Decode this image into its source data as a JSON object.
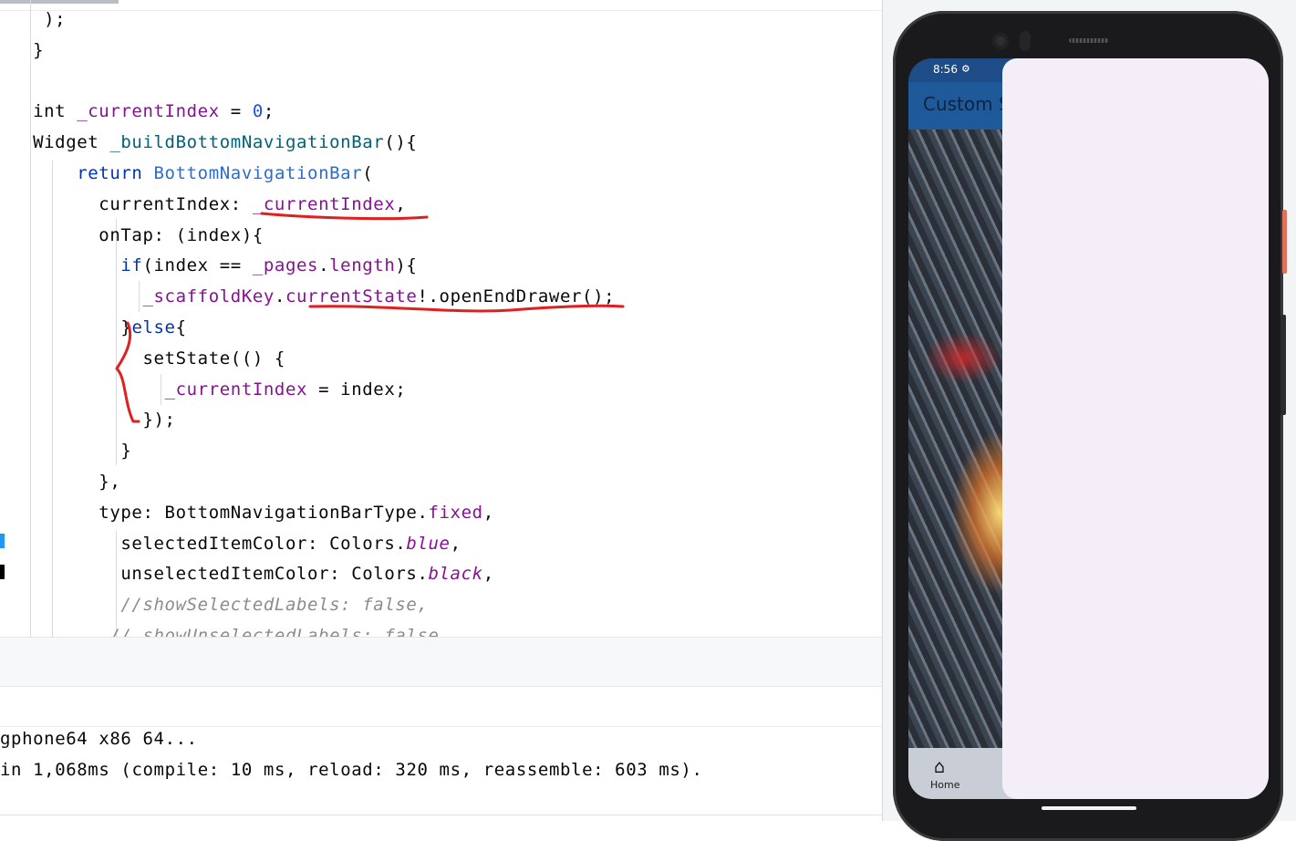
{
  "editor": {
    "lines": [
      [
        {
          "t": "   );",
          "c": ""
        }
      ],
      [
        {
          "t": "  }",
          "c": ""
        }
      ],
      [
        {
          "t": "",
          "c": ""
        }
      ],
      [
        {
          "t": "  int ",
          "c": ""
        },
        {
          "t": "_currentIndex",
          "c": "fld"
        },
        {
          "t": " = ",
          "c": ""
        },
        {
          "t": "0",
          "c": "num"
        },
        {
          "t": ";",
          "c": ""
        }
      ],
      [
        {
          "t": "  Widget ",
          "c": ""
        },
        {
          "t": "_buildBottomNavigationBar",
          "c": "fn"
        },
        {
          "t": "(){",
          "c": ""
        }
      ],
      [
        {
          "t": "      ",
          "c": ""
        },
        {
          "t": "return ",
          "c": "kw"
        },
        {
          "t": "BottomNavigationBar",
          "c": "cls"
        },
        {
          "t": "(",
          "c": ""
        }
      ],
      [
        {
          "t": "        currentIndex: ",
          "c": ""
        },
        {
          "t": "_currentIndex",
          "c": "fld"
        },
        {
          "t": ",",
          "c": ""
        }
      ],
      [
        {
          "t": "        onTap: (index){",
          "c": ""
        }
      ],
      [
        {
          "t": "          ",
          "c": ""
        },
        {
          "t": "if",
          "c": "kw"
        },
        {
          "t": "(index == ",
          "c": ""
        },
        {
          "t": "_pages",
          "c": "fld"
        },
        {
          "t": ".",
          "c": ""
        },
        {
          "t": "length",
          "c": "fld"
        },
        {
          "t": "){",
          "c": ""
        }
      ],
      [
        {
          "t": "            ",
          "c": ""
        },
        {
          "t": "_scaffoldKey",
          "c": "fld"
        },
        {
          "t": ".",
          "c": ""
        },
        {
          "t": "currentState",
          "c": "fld"
        },
        {
          "t": "!.openEndDrawer();",
          "c": ""
        }
      ],
      [
        {
          "t": "          }",
          "c": ""
        },
        {
          "t": "else",
          "c": "kw"
        },
        {
          "t": "{",
          "c": ""
        }
      ],
      [
        {
          "t": "            setState(() {",
          "c": ""
        }
      ],
      [
        {
          "t": "              ",
          "c": ""
        },
        {
          "t": "_currentIndex",
          "c": "fld"
        },
        {
          "t": " = index;",
          "c": ""
        }
      ],
      [
        {
          "t": "            });",
          "c": ""
        }
      ],
      [
        {
          "t": "          }",
          "c": ""
        }
      ],
      [
        {
          "t": "        },",
          "c": ""
        }
      ],
      [
        {
          "t": "        type: BottomNavigationBarType.",
          "c": ""
        },
        {
          "t": "fixed",
          "c": "fld"
        },
        {
          "t": ",",
          "c": ""
        }
      ],
      [
        {
          "t": "          selectedItemColor: Colors.",
          "c": ""
        },
        {
          "t": "blue",
          "c": "itl"
        },
        {
          "t": ",",
          "c": ""
        }
      ],
      [
        {
          "t": "          unselectedItemColor: Colors.",
          "c": ""
        },
        {
          "t": "black",
          "c": "itl"
        },
        {
          "t": ",",
          "c": ""
        }
      ],
      [
        {
          "t": "          //showSelectedLabels: false,",
          "c": "cmt"
        }
      ],
      [
        {
          "t": "         // showUnselectedLabels: false",
          "c": "cmt"
        }
      ]
    ]
  },
  "console": {
    "line1": "gphone64 x86 64...",
    "line2": "in 1,068ms (compile: 10 ms, reload: 320 ms, reassemble: 603 ms)."
  },
  "emulator": {
    "status_time": "8:56",
    "app_title": "Custom Scaffold",
    "nav_home_label": "Home",
    "icons": {
      "status_settings": "gear-icon",
      "status_right": "wifi-signal-battery-icon",
      "nav_home": "home-icon"
    },
    "colors": {
      "drawer": "#f4eef8",
      "app_bar": "#1e5a9a",
      "annotation": "#e02020"
    }
  }
}
